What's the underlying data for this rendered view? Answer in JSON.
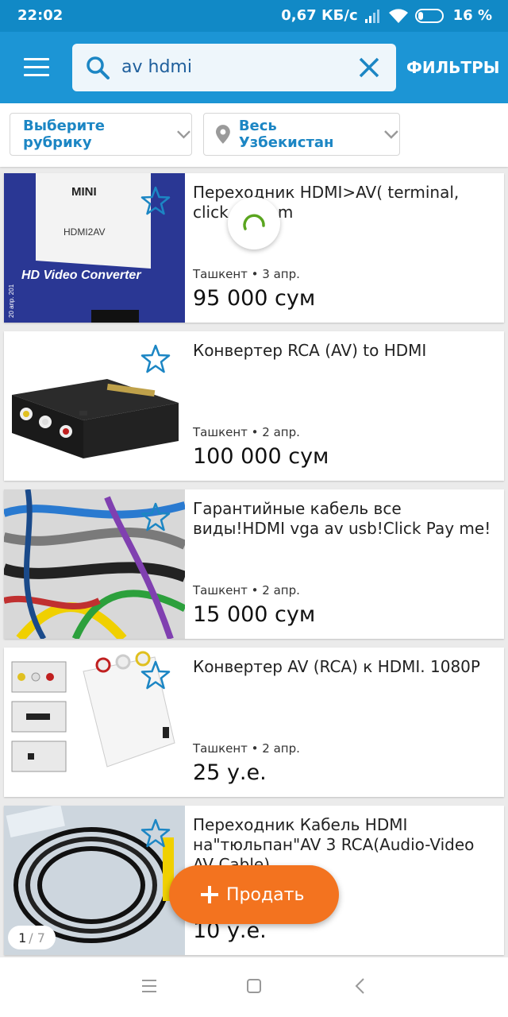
{
  "status": {
    "time": "22:02",
    "speed": "0,67 КБ/с",
    "battery": "16 %"
  },
  "search": {
    "query": "av hdmi",
    "filters_label": "ФИЛЬТРЫ"
  },
  "category": {
    "label": "Выберите рубрику"
  },
  "location": {
    "label": "Весь Узбекистан"
  },
  "listings": [
    {
      "title": "Переходник HDMI>AV( terminal, click , pay m",
      "meta": "Ташкент • 3 апр.",
      "price": "95 000 сум"
    },
    {
      "title": "Конвертер RCA (AV) to HDMI",
      "meta": "Ташкент • 2 апр.",
      "price": "100 000 сум"
    },
    {
      "title": "Гарантийные кабель все виды!HDMI vga av usb!Click Pay me!",
      "meta": "Ташкент • 2 апр.",
      "price": "15 000 сум"
    },
    {
      "title": "Конвертер AV (RCA) к HDMI. 1080P",
      "meta": "Ташкент • 2 апр.",
      "price": "25 у.е."
    },
    {
      "title": "Переходник Кабель HDMI на\"тюльпан\"AV 3 RCA(Audio-Video AV Cable)",
      "meta": "",
      "price": "10 у.е."
    }
  ],
  "thumb_texts": {
    "mini": "MINI",
    "hdmi2av": "HDMI2AV",
    "hd_converter": "HD Video Converter",
    "date": "20 апр. 201"
  },
  "photo_counter": {
    "current": "1",
    "total": "/ 7"
  },
  "sell_button": {
    "label": "Продать"
  },
  "colors": {
    "primary": "#1c95d5",
    "accent": "#f3731f",
    "link": "#1c86c4"
  },
  "icons": [
    "menu-icon",
    "search-icon",
    "close-icon",
    "chevron-down-icon",
    "location-pin-icon",
    "star-icon",
    "plus-icon",
    "nav-menu-icon",
    "nav-home-icon",
    "nav-back-icon"
  ]
}
